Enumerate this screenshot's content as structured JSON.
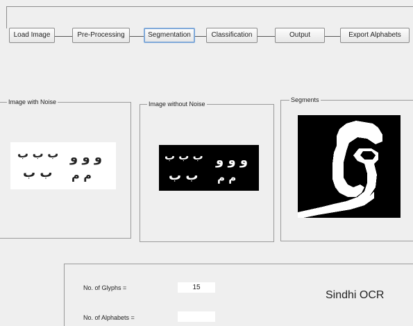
{
  "toolbar": {
    "buttons": [
      {
        "label": "Load Image",
        "active": false
      },
      {
        "label": "Pre-Processing",
        "active": false
      },
      {
        "label": "Segmentation",
        "active": true
      },
      {
        "label": "Classification",
        "active": false
      },
      {
        "label": "Output",
        "active": false
      },
      {
        "label": "Export Alphabets",
        "active": false
      }
    ]
  },
  "panels": {
    "noise": {
      "title": "Image with Noise"
    },
    "no_noise": {
      "title": "Image without Noise"
    },
    "segments": {
      "title": "Segments"
    }
  },
  "glyphs": {
    "row1_left": "ب ب ب",
    "row1_right": "و و و",
    "row2_left": "ب ب",
    "row2_right": "م م"
  },
  "info": {
    "glyphs_label": "No. of Glyphs =",
    "glyphs_value": "15",
    "alphabets_label": "No. of Alphabets =",
    "alphabets_value": "",
    "app_title": "Sindhi OCR"
  },
  "colors": {
    "window_bg": "#efefef",
    "active_button_border": "#7fa9d9",
    "image_dark": "#000000",
    "image_light": "#ffffff"
  }
}
